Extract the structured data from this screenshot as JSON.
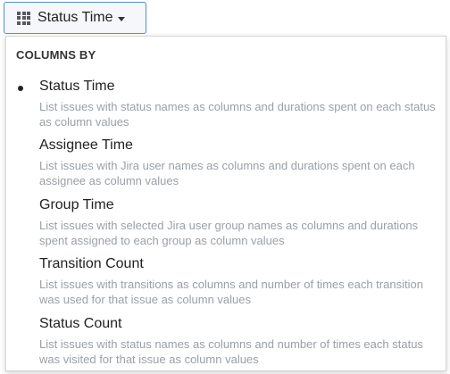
{
  "toggle": {
    "label": "Status Time",
    "icon": "grid-icon"
  },
  "dropdown": {
    "header": "COLUMNS BY",
    "selected_index": 0,
    "options": [
      {
        "title": "Status Time",
        "desc": "List issues with status names as columns and durations spent on each status as column values"
      },
      {
        "title": "Assignee Time",
        "desc": "List issues with Jira user names as columns and durations spent on each assignee as column values"
      },
      {
        "title": "Group Time",
        "desc": "List issues with selected Jira user group names as columns and durations spent assigned to each group as column values"
      },
      {
        "title": "Transition Count",
        "desc": "List issues with transitions as columns and number of times each transition was used for that issue as column values"
      },
      {
        "title": "Status Count",
        "desc": "List issues with status names as columns and number of times each status was visited for that issue as column values"
      }
    ]
  },
  "colors": {
    "border_accent": "#4a90d9",
    "title_text": "#222222",
    "desc_text": "#9aa0a6"
  }
}
